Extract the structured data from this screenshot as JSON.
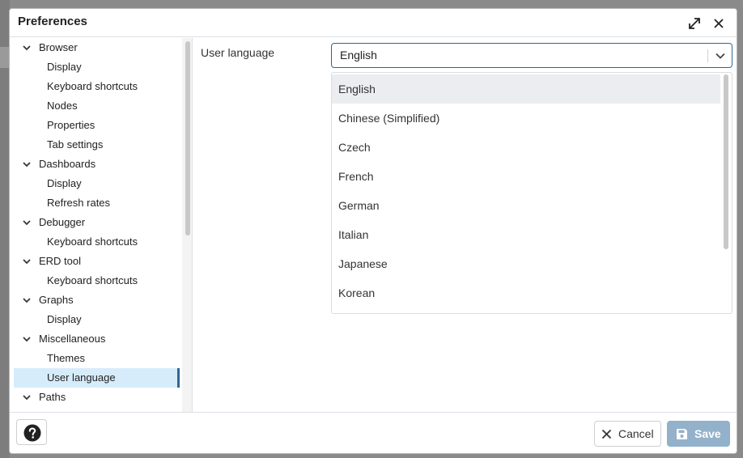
{
  "dialog": {
    "title": "Preferences"
  },
  "tree": {
    "groups": [
      {
        "label": "Browser",
        "children": [
          "Display",
          "Keyboard shortcuts",
          "Nodes",
          "Properties",
          "Tab settings"
        ]
      },
      {
        "label": "Dashboards",
        "children": [
          "Display",
          "Refresh rates"
        ]
      },
      {
        "label": "Debugger",
        "children": [
          "Keyboard shortcuts"
        ]
      },
      {
        "label": "ERD tool",
        "children": [
          "Keyboard shortcuts"
        ]
      },
      {
        "label": "Graphs",
        "children": [
          "Display"
        ]
      },
      {
        "label": "Miscellaneous",
        "children": [
          "Themes",
          "User language"
        ]
      },
      {
        "label": "Paths",
        "children": []
      }
    ],
    "selected": "User language"
  },
  "form": {
    "field_label": "User language",
    "select_value": "English",
    "options": [
      "English",
      "Chinese (Simplified)",
      "Czech",
      "French",
      "German",
      "Italian",
      "Japanese",
      "Korean"
    ]
  },
  "footer": {
    "cancel_label": "Cancel",
    "save_label": "Save"
  },
  "colors": {
    "accent": "#326690",
    "selected_bg": "#d6ecfb",
    "save_bg": "#93b1ca"
  },
  "icons": {
    "maximize": "expand-arrows-icon",
    "close": "close-icon",
    "chevron": "chevron-down-icon",
    "help": "question-circle-icon",
    "cancel": "close-icon",
    "save": "floppy-disk-icon"
  }
}
